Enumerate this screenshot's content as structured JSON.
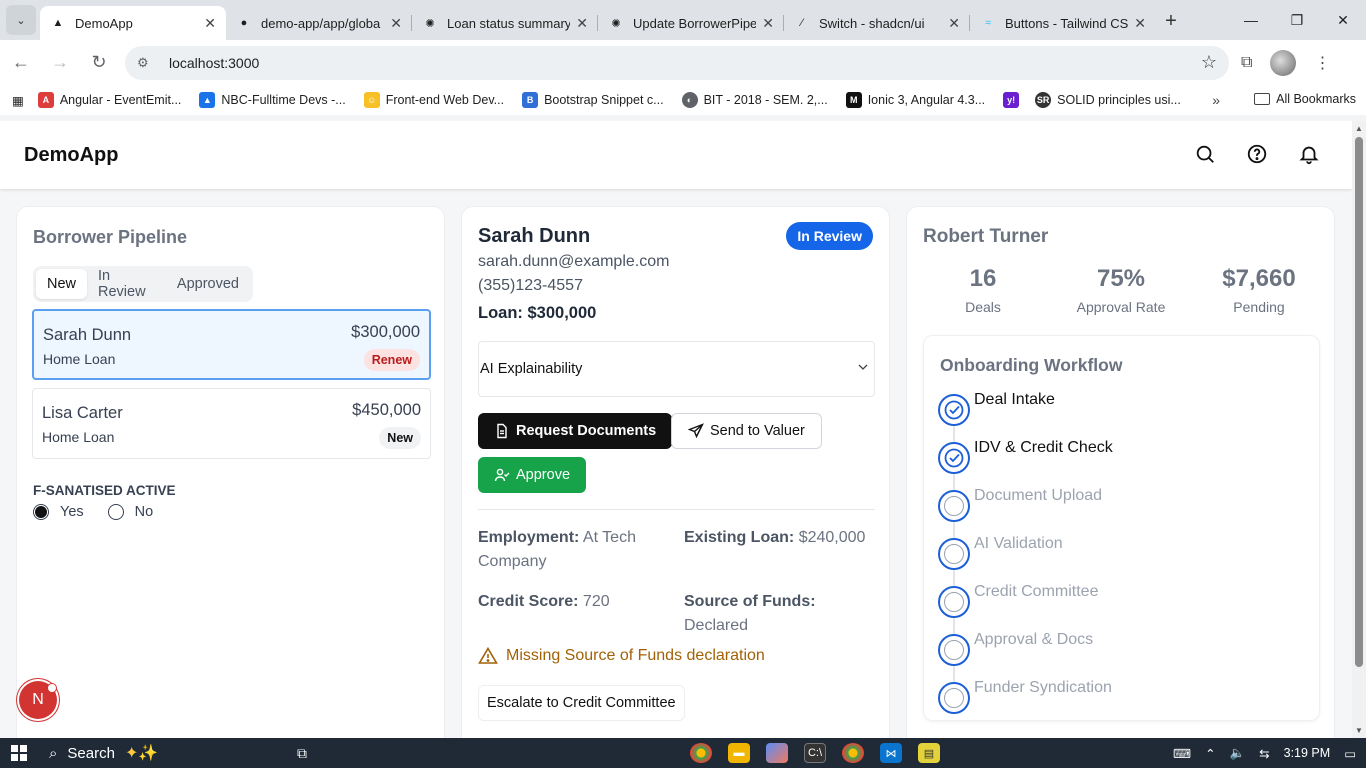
{
  "browser": {
    "tabs": [
      {
        "title": "DemoApp",
        "active": true
      },
      {
        "title": "demo-app/app/globa",
        "active": false
      },
      {
        "title": "Loan status summary",
        "active": false
      },
      {
        "title": "Update BorrowerPipe",
        "active": false
      },
      {
        "title": "Switch - shadcn/ui",
        "active": false
      },
      {
        "title": "Buttons - Tailwind CS",
        "active": false
      }
    ],
    "url": "localhost:3000",
    "bookmarks": [
      {
        "label": "Angular - EventEmit...",
        "color": "#dd3d3d"
      },
      {
        "label": "NBC-Fulltime Devs -...",
        "color": "#1a73e8"
      },
      {
        "label": "Front-end Web Dev...",
        "color": "#f6c026"
      },
      {
        "label": "Bootstrap Snippet c...",
        "color": "#2f6fd6"
      },
      {
        "label": "BIT - 2018 - SEM. 2,...",
        "color": "#5f6368"
      },
      {
        "label": "Ionic 3, Angular 4.3...",
        "color": "#111111"
      },
      {
        "label": "",
        "color": "#6a1fd0"
      },
      {
        "label": "SOLID principles usi...",
        "color": "#333333"
      }
    ],
    "all_bookmarks": "All Bookmarks"
  },
  "app": {
    "brand": "DemoApp",
    "header_icons": [
      "search-icon",
      "help-icon",
      "bell-icon"
    ]
  },
  "pipeline": {
    "title": "Borrower Pipeline",
    "tabs": [
      "New",
      "In Review",
      "Approved"
    ],
    "active_tab": "New",
    "borrowers": [
      {
        "name": "Sarah Dunn",
        "type": "Home Loan",
        "amount": "$300,000",
        "badge": "Renew",
        "selected": true
      },
      {
        "name": "Lisa Carter",
        "type": "Home Loan",
        "amount": "$450,000",
        "badge": "New",
        "selected": false
      }
    ],
    "f_sanitised": {
      "label": "F-SANATISED ACTIVE",
      "options": [
        "Yes",
        "No"
      ],
      "selected": "Yes"
    },
    "avatar_letter": "N"
  },
  "detail": {
    "name": "Sarah Dunn",
    "status": "In Review",
    "email": "sarah.dunn@example.com",
    "phone": "(355)123-4557",
    "loan": "Loan: $300,000",
    "accordion": "AI Explainability",
    "buttons": {
      "request_docs": "Request Documents",
      "send_valuer": "Send to Valuer",
      "approve": "Approve",
      "escalate": "Escalate to Credit Committee"
    },
    "fields": [
      {
        "label": "Employment:",
        "value": "At Tech Company"
      },
      {
        "label": "Existing Loan:",
        "value": "$240,000"
      },
      {
        "label": "Credit Score:",
        "value": "720"
      },
      {
        "label": "Source of Funds:",
        "value": "Declared"
      }
    ],
    "warning": "Missing Source of Funds declaration"
  },
  "agent": {
    "name": "Robert Turner",
    "stats": [
      {
        "value": "16",
        "label": "Deals"
      },
      {
        "value": "75%",
        "label": "Approval Rate"
      },
      {
        "value": "$7,660",
        "label": "Pending"
      }
    ],
    "workflow_title": "Onboarding Workflow",
    "steps": [
      {
        "label": "Deal Intake",
        "done": true
      },
      {
        "label": "IDV & Credit Check",
        "done": true
      },
      {
        "label": "Document Upload",
        "done": false
      },
      {
        "label": "AI Validation",
        "done": false
      },
      {
        "label": "Credit Committee",
        "done": false
      },
      {
        "label": "Approval & Docs",
        "done": false
      },
      {
        "label": "Funder Syndication",
        "done": false
      }
    ]
  },
  "taskbar": {
    "search": "Search",
    "time": "3:19 PM"
  },
  "colors": {
    "primary_blue": "#1565e8",
    "approve_green": "#16a34a",
    "warning": "#a16207",
    "renew_bg": "#fde2e2"
  }
}
